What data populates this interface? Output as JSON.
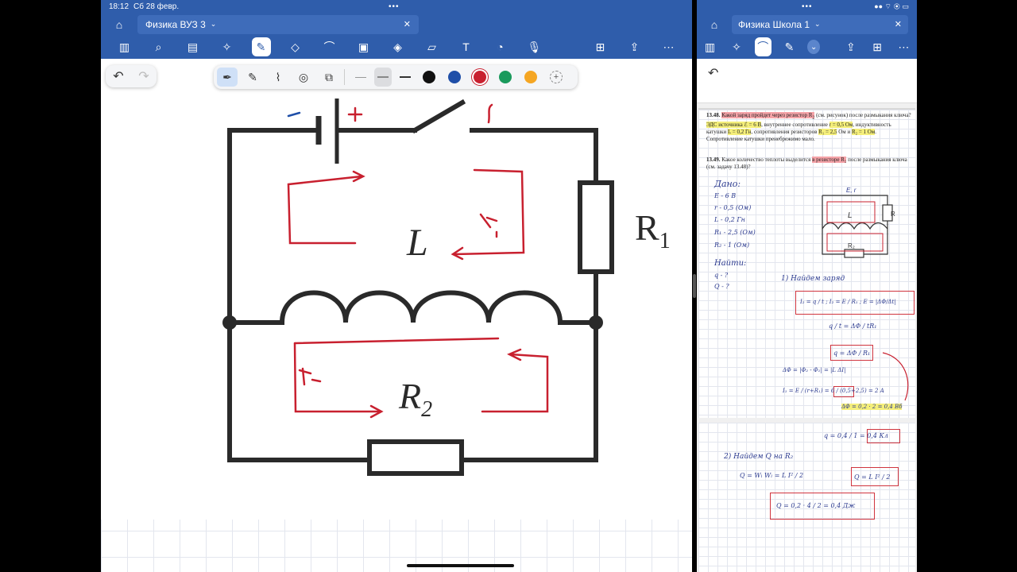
{
  "status": {
    "time": "18:12",
    "date": "Сб 28 февр."
  },
  "left": {
    "tab_title": "Физика ВУЗ 3",
    "toolbar_icons": [
      "sidebar-icon",
      "search-icon",
      "document-icon",
      "sparkle-icon",
      "pen-icon",
      "eraser-icon",
      "lasso-icon",
      "image-icon",
      "shapes-icon",
      "sticky-icon",
      "textbox-icon",
      "sticker-icon",
      "mic-icon",
      "add-page-icon",
      "share-icon",
      "more-icon"
    ],
    "circuit": {
      "r1_letter": "R",
      "r1_sub": "1",
      "l_label": "L",
      "r2_letter": "R",
      "r2_sub": "2"
    },
    "colors": [
      "#111111",
      "#1f4fa8",
      "#c8202f",
      "#1a9a5c",
      "#f5a623"
    ]
  },
  "right": {
    "tab_title": "Физика Школа 1",
    "task_13_48_num": "13.48.",
    "task_13_48_a": "Какой заряд пройдет через резистор R",
    "task_13_48_a_sub": "2",
    "task_13_48_b": " (см. рисунок) после размыкания ключа? ",
    "task_13_48_c": "ЭДС источника ℰ = 6 В",
    "task_13_48_d": ", внутреннее сопротивление ",
    "task_13_48_e": "r = 0,5 Ом",
    "task_13_48_f": ", индуктивность катушки ",
    "task_13_48_g": "L = 0,2 Гн",
    "task_13_48_h": ", сопротивления резисторов ",
    "task_13_48_i": "R₁ = 2,5",
    "task_13_48_j": " Ом и ",
    "task_13_48_k": "R₂ = 1 Ом",
    "task_13_48_l": ". Сопротивление катушки пренебрежимо мало.",
    "task_13_49_num": "13.49.",
    "task_13_49_a": "Какое количество теплоты выделится ",
    "task_13_49_b": "в резисторе R₂",
    "task_13_49_c": " после размыкания ключа (см. задачу 13.48)?",
    "given_title": "Дано:",
    "given": [
      "E - 6 В",
      "r - 0,5 (Ом)",
      "L - 0,2 Гн",
      "R₁ - 2,5 (Ом)",
      "R₂ - 1 (Ом)"
    ],
    "find_title": "Найти:",
    "find": [
      "q - ?",
      "Q - ?"
    ],
    "step1": "1) Найдем заряд",
    "step2": "2) Найдем Q на R₂",
    "eq_i2": "I₂ = q / t ;   I₂ = E / R₁ ;  E = |ΔΦ/Δt|",
    "eq_q_frac": "q / t = ΔΦ / tR₁",
    "eq_q_box": "q = ΔΦ / R₁",
    "eq_dphi": "ΔΦ = |Φ₂ - Φ₁| = |L ΔI|",
    "eq_i1": "I₁ = E / (r+R₁) = 6 / (0,5+2,5) = 2 A",
    "eq_dphi_val": "ΔΦ = 0,2 · 2 = 0,4 Вб",
    "eq_q_val": "q = 0,4 / 1 = 0,4 Кл",
    "eq_energy": "Q = Wₗ     Wₗ = L I² / 2",
    "eq_energy_box": "Q = L I² / 2",
    "eq_final": "Q = 0,2 · 4 / 2 = 0,4 Дж"
  }
}
